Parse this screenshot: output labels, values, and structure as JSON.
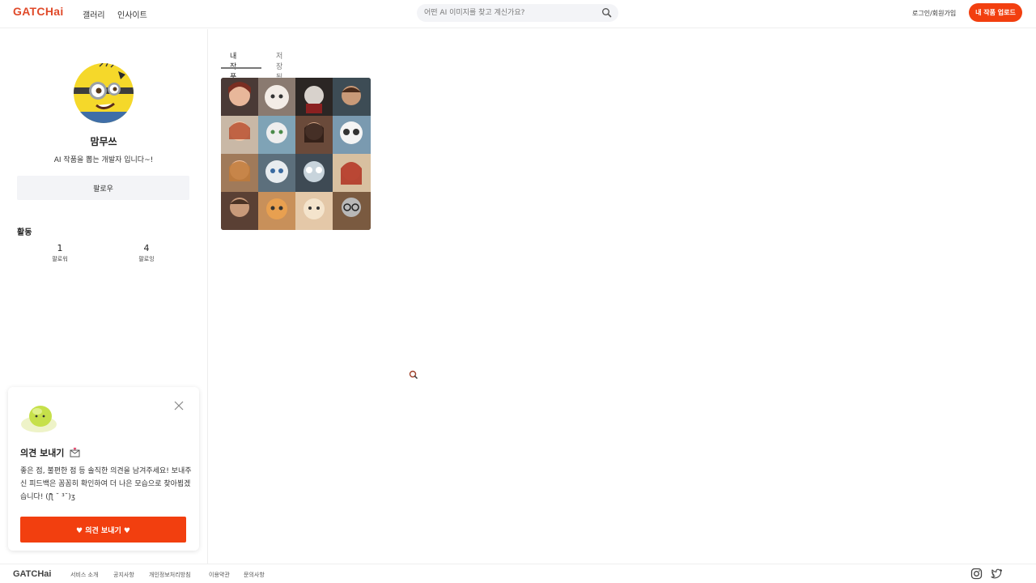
{
  "header": {
    "logo": "GATCHai",
    "nav": [
      "갤러리",
      "인사이트"
    ],
    "search_placeholder": "어떤 AI 이미지를 찾고 계신가요?",
    "login": "로그인/회원가입",
    "upload": "내 작품 업로드"
  },
  "profile": {
    "name": "맘무쓰",
    "bio": "AI 작품을 뽑는 개발자 입니다~!",
    "follow_button": "팔로우",
    "activity_title": "활동",
    "stats": [
      {
        "value": "1",
        "label": "팔로워"
      },
      {
        "value": "4",
        "label": "팔로잉"
      }
    ]
  },
  "feedback": {
    "title": "의견 보내기",
    "text": "좋은 점, 불편한 점 등 솔직한 의견을 남겨주세요! 보내주신 피드백은 꼼꼼히 확인하여 더 나은 모습으로 찾아뵙겠습니다! (ʃƪ ˘ ³˘)ʒ",
    "button": "♥ 의견 보내기 ♥"
  },
  "tabs": [
    "내 작품",
    "저장됨"
  ],
  "footer": {
    "logo": "GATCHai",
    "links": [
      "서비스 소개",
      "공지사항",
      "개인정보처리방침",
      "이용약관",
      "문의사항"
    ],
    "social": [
      "instagram-icon",
      "twitter-icon"
    ]
  },
  "colors": {
    "accent": "#f23f0f",
    "logo": "#e04a2a",
    "search_bg": "#f3f4f7"
  }
}
